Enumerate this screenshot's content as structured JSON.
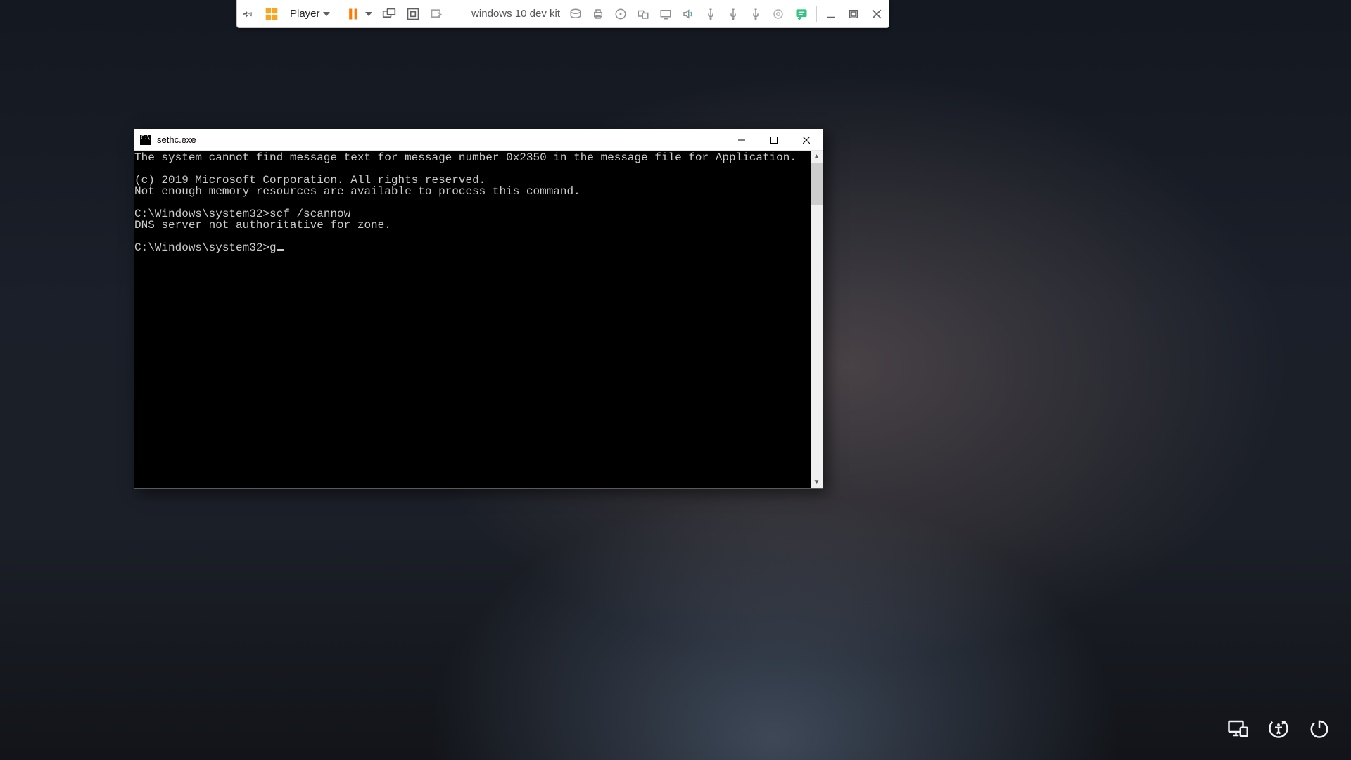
{
  "vm_toolbar": {
    "player_label": "Player",
    "vm_name": "windows 10 dev kit"
  },
  "cmd": {
    "title": "sethc.exe",
    "lines": [
      "The system cannot find message text for message number 0x2350 in the message file for Application.",
      "",
      "(c) 2019 Microsoft Corporation. All rights reserved.",
      "Not enough memory resources are available to process this command.",
      "",
      "C:\\Windows\\system32>scf /scannow",
      "DNS server not authoritative for zone.",
      "",
      "C:\\Windows\\system32>g"
    ]
  }
}
